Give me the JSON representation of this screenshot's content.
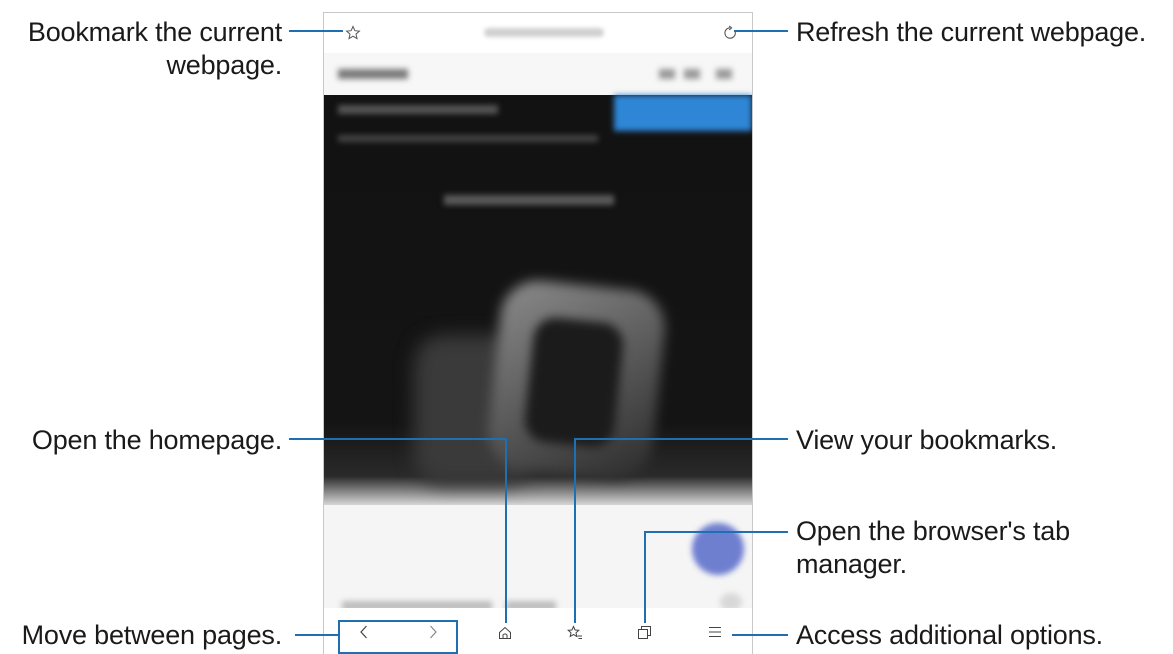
{
  "callouts": {
    "bookmark_line1": "Bookmark the current",
    "bookmark_line2": "webpage.",
    "refresh": "Refresh the current webpage.",
    "homepage": "Open the homepage.",
    "view_bookmarks": "View your bookmarks.",
    "tab_manager_line1": "Open the browser's tab",
    "tab_manager_line2": "manager.",
    "move_pages": "Move between pages.",
    "additional_options": "Access additional options."
  },
  "top_toolbar": {
    "icons": [
      "star-outline-icon",
      "refresh-icon"
    ]
  },
  "bottom_toolbar": {
    "icons": [
      "back-icon",
      "forward-icon",
      "home-icon",
      "bookmarks-icon",
      "tabs-icon",
      "menu-icon"
    ]
  },
  "colors": {
    "accent_line": "#1f6fb3",
    "site_banner": "#2f86d6",
    "page_dark": "#121212"
  }
}
